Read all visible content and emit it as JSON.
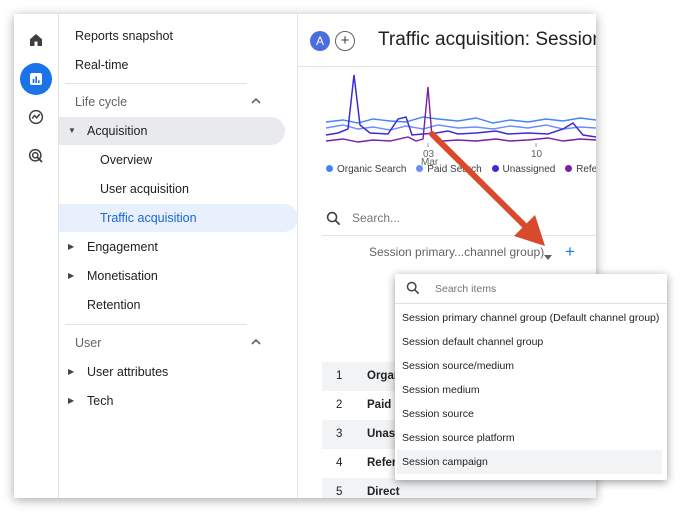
{
  "rail": {
    "items": [
      {
        "icon": "home-icon"
      },
      {
        "icon": "reports-icon",
        "active": true
      },
      {
        "icon": "explore-icon"
      },
      {
        "icon": "advertising-icon"
      }
    ]
  },
  "sidebar": {
    "top_items": [
      "Reports snapshot",
      "Real-time"
    ],
    "lifecycle": {
      "heading": "Life cycle",
      "acquisition": "Acquisition",
      "acquisition_children": [
        "Overview",
        "User acquisition",
        "Traffic acquisition"
      ],
      "engagement": "Engagement",
      "monetisation": "Monetisation",
      "retention": "Retention"
    },
    "user": {
      "heading": "User",
      "user_attributes": "User attributes",
      "tech": "Tech"
    }
  },
  "header": {
    "avatar": "A",
    "add": "+",
    "title": "Traffic acquisition: Session primary channel group"
  },
  "chart": {
    "x_ticks": [
      "03",
      "10"
    ],
    "x_month": "Mar",
    "colors": {
      "organic": "#4285f4",
      "paid": "#6b8cff",
      "unassigned": "#3d2bd6",
      "referral": "#7b1fa2"
    }
  },
  "legend": [
    "Organic Search",
    "Paid Search",
    "Unassigned",
    "Referral"
  ],
  "search": {
    "placeholder": "Search..."
  },
  "dimension": {
    "label": "Session primary...channel group)",
    "add": "+"
  },
  "table": {
    "rows": [
      {
        "num": "1",
        "name": "Organic Search"
      },
      {
        "num": "2",
        "name": "Paid Search"
      },
      {
        "num": "3",
        "name": "Unassigned"
      },
      {
        "num": "4",
        "name": "Referral"
      },
      {
        "num": "5",
        "name": "Direct"
      }
    ]
  },
  "popup": {
    "search_placeholder": "Search items",
    "items": [
      "Session primary channel group (Default channel group)",
      "Session default channel group",
      "Session source/medium",
      "Session medium",
      "Session source",
      "Session source platform",
      "Session campaign"
    ],
    "highlighted_index": 6
  },
  "annotation": {
    "arrow_color": "#d84a2b"
  }
}
